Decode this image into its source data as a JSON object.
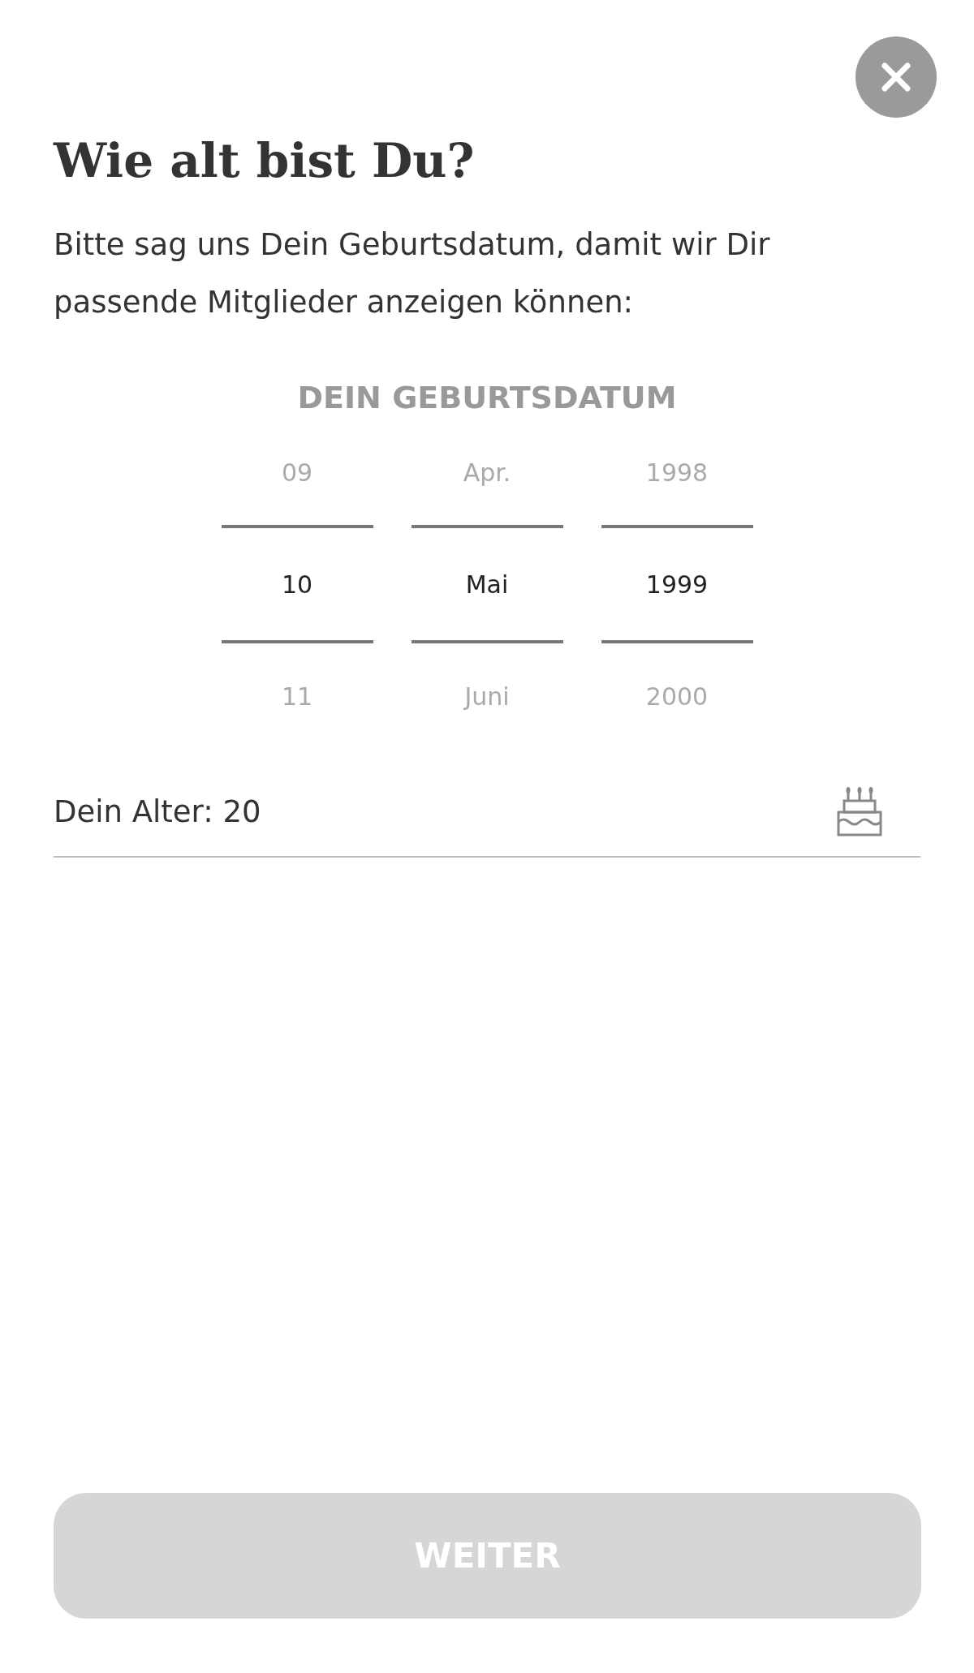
{
  "title": "Wie alt bist Du?",
  "intro": "Bitte sag uns Dein Geburtsdatum, damit wir Dir passende Mitglieder anzeigen können:",
  "picker": {
    "label": "DEIN GEBURTSDATUM",
    "columns": [
      {
        "items": [
          {
            "label": "09",
            "selected": false
          },
          {
            "label": "10",
            "selected": true
          },
          {
            "label": "11",
            "selected": false
          }
        ]
      },
      {
        "items": [
          {
            "label": "Apr.",
            "selected": false
          },
          {
            "label": "Mai",
            "selected": true
          },
          {
            "label": "Juni",
            "selected": false
          }
        ]
      },
      {
        "items": [
          {
            "label": "1998",
            "selected": false
          },
          {
            "label": "1999",
            "selected": true
          },
          {
            "label": "2000",
            "selected": false
          }
        ]
      }
    ]
  },
  "age": "Dein Alter: 20",
  "button": {
    "label": "WEITER",
    "disabled": true
  }
}
